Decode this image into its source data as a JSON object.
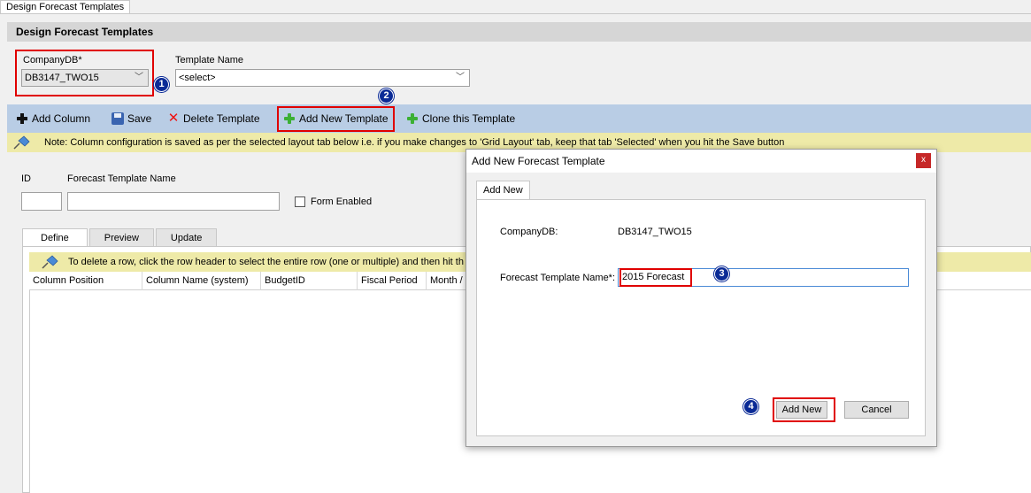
{
  "window": {
    "doc_tab": "Design Forecast Templates"
  },
  "section": {
    "title": "Design Forecast Templates"
  },
  "form": {
    "company_label": "CompanyDB*",
    "company_value": "DB3147_TWO15",
    "template_label": "Template Name",
    "template_value": "<select>",
    "id_label": "ID",
    "name_label": "Forecast Template Name",
    "form_enabled_label": "Form Enabled"
  },
  "toolbar": {
    "add_column": "Add Column",
    "save": "Save",
    "delete_template": "Delete Template",
    "add_new_template": "Add New Template",
    "clone_template": "Clone this Template"
  },
  "note": "Note: Column configuration is saved as per the selected layout tab below i.e. if you make changes to 'Grid Layout' tab, keep that tab 'Selected' when you hit the Save button",
  "tabs": [
    "Define",
    "Preview",
    "Update"
  ],
  "grid": {
    "note": "To delete a row, click the row header to select the entire row (one or multiple) and then hit th",
    "columns": [
      "Column Position",
      "Column Name (system)",
      "BudgetID",
      "Fiscal Period",
      "Month /"
    ]
  },
  "dialog": {
    "title": "Add New Forecast Template",
    "close": "x",
    "tab": "Add New",
    "company_label": "CompanyDB:",
    "company_value": "DB3147_TWO15",
    "name_label": "Forecast Template Name*:",
    "name_value": "2015 Forecast",
    "add_button": "Add New",
    "cancel_button": "Cancel"
  },
  "badges": [
    "1",
    "2",
    "3",
    "4"
  ],
  "colors": {
    "toolbar": "#b9cde5",
    "note_bg": "#eeeaa8",
    "highlight": "#e00000",
    "badge": "#0a2a96"
  }
}
